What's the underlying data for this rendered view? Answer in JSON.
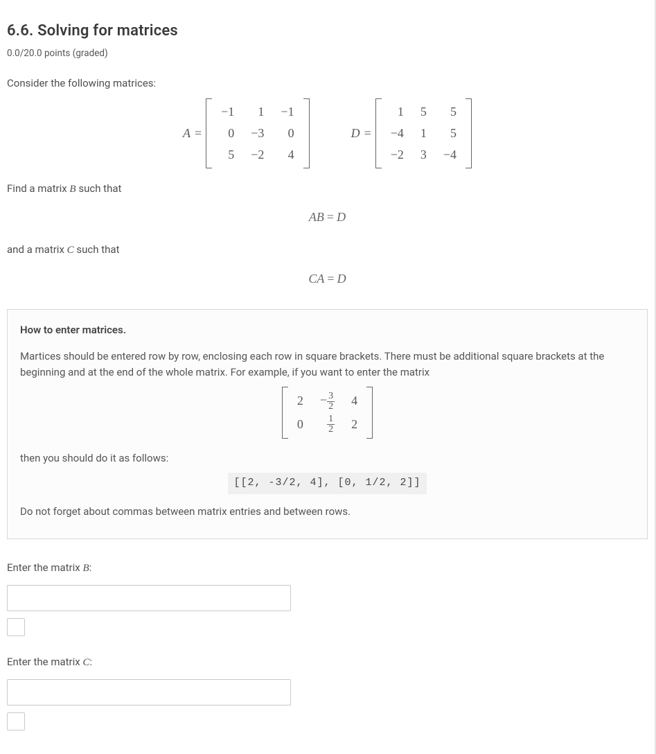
{
  "title": "6.6. Solving for matrices",
  "points": "0.0/20.0 points (graded)",
  "intro": "Consider the following matrices:",
  "matrixA": {
    "label": "A",
    "rows": [
      [
        "−1",
        "1",
        "−1"
      ],
      [
        "0",
        "−3",
        "0"
      ],
      [
        "5",
        "−2",
        "4"
      ]
    ]
  },
  "matrixD": {
    "label": "D",
    "rows": [
      [
        "1",
        "5",
        "5"
      ],
      [
        "−4",
        "1",
        "5"
      ],
      [
        "−2",
        "3",
        "−4"
      ]
    ]
  },
  "prompt_findB": "Find a matrix",
  "prompt_findB_var": "B",
  "prompt_findB_tail": "such that",
  "eq1_lhs": "AB",
  "eq1_rhs": "D",
  "prompt_findC": "and a matrix",
  "prompt_findC_var": "C",
  "prompt_findC_tail": "such that",
  "eq2_lhs": "CA",
  "eq2_rhs": "D",
  "infobox": {
    "title": "How to enter matrices.",
    "p1": "Martices should be entered row by row, enclosing each row in square brackets. There must be additional square brackets at the beginning and at the end of the whole matrix. For example, if you want to enter the matrix",
    "example_matrix": [
      [
        "2",
        "−3/2",
        "4"
      ],
      [
        "0",
        "1/2",
        "2"
      ]
    ],
    "p2": "then you should do it as follows:",
    "code": "[[2, -3/2, 4], [0, 1/2, 2]]",
    "p3": "Do not forget about commas between matrix entries and between rows."
  },
  "inputs": {
    "labelB_pre": "Enter the matrix",
    "labelB_var": "B",
    "labelC_pre": "Enter the matrix",
    "labelC_var": "C"
  }
}
